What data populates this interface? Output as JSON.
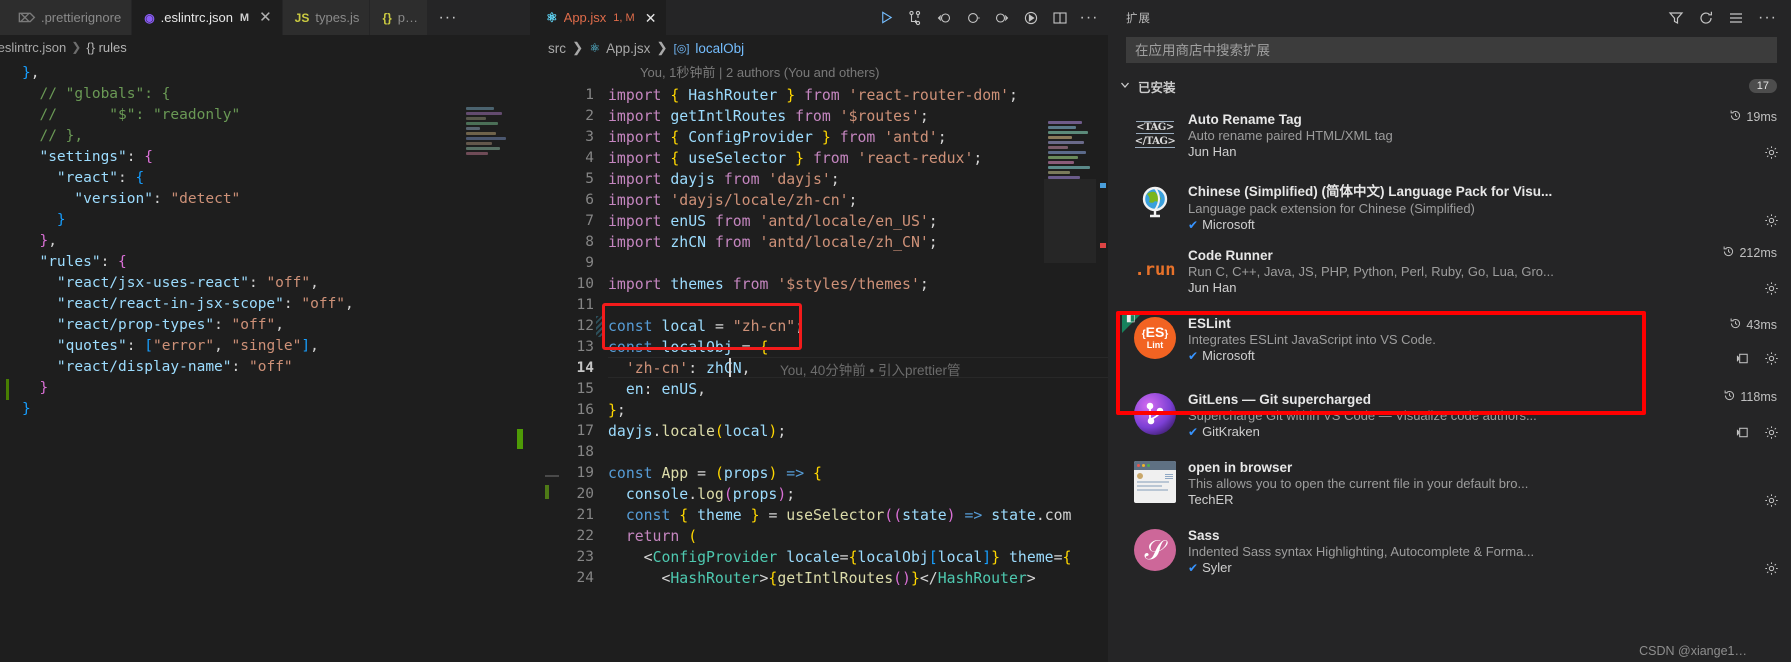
{
  "left_editor": {
    "tabs": [
      {
        "label": ".prettierignore",
        "icon": "file-icon",
        "active": false,
        "dirty": "",
        "closable": false
      },
      {
        "label": ".eslintrc.json",
        "icon": "eslint-icon",
        "active": true,
        "dirty": "M",
        "closable": true
      },
      {
        "label": "types.js",
        "icon": "js-icon",
        "active": false,
        "dirty": "",
        "closable": false
      },
      {
        "label": "package.json",
        "icon": "json-icon",
        "active": false,
        "dirty": "",
        "closable": false
      }
    ],
    "more_label": "···",
    "breadcrumb": [
      ".eslintrc.json",
      "{} rules"
    ],
    "code_lines": [
      "  },",
      "  // \"globals\": {",
      "  //      \"$\": \"readonly\"",
      "  // },",
      "  \"settings\": {",
      "    \"react\": {",
      "      \"version\": \"detect\"",
      "    }",
      "  },",
      "  \"rules\": {",
      "    \"react/jsx-uses-react\": \"off\",",
      "    \"react/react-in-jsx-scope\": \"off\",",
      "    \"react/prop-types\": \"off\",",
      "    \"quotes\": [\"error\", \"single\"],",
      "    \"react/display-name\": \"off\"",
      "  }",
      "}"
    ]
  },
  "main_editor": {
    "tab": {
      "label": "App.jsx",
      "badge": "1, M",
      "close": "✕",
      "icon": "react-icon"
    },
    "actions": [
      {
        "name": "run-button",
        "glyph": "▷"
      },
      {
        "name": "source-control-icon",
        "glyph": "git"
      },
      {
        "name": "debug-step-back-icon",
        "glyph": "back"
      },
      {
        "name": "debug-restart-icon",
        "glyph": "circle"
      },
      {
        "name": "debug-step-over-icon",
        "glyph": "fwd"
      },
      {
        "name": "run-and-debug-icon",
        "glyph": "play-circle"
      },
      {
        "name": "split-editor-icon",
        "glyph": "split"
      },
      {
        "name": "more-actions-icon",
        "glyph": "···"
      }
    ],
    "breadcrumb": [
      "src",
      "App.jsx",
      "localObj"
    ],
    "blame_header": "You, 1秒钟前 | 2 authors (You and others)",
    "inline_blame": "You, 40分钟前 • 引入prettier管",
    "lines": [
      {
        "n": 1,
        "text": "import { HashRouter } from 'react-router-dom';"
      },
      {
        "n": 2,
        "text": "import getIntlRoutes from '$routes';"
      },
      {
        "n": 3,
        "text": "import { ConfigProvider } from 'antd';"
      },
      {
        "n": 4,
        "text": "import { useSelector } from 'react-redux';"
      },
      {
        "n": 5,
        "text": "import dayjs from 'dayjs';"
      },
      {
        "n": 6,
        "text": "import 'dayjs/locale/zh-cn';"
      },
      {
        "n": 7,
        "text": "import enUS from 'antd/locale/en_US';"
      },
      {
        "n": 8,
        "text": "import zhCN from 'antd/locale/zh_CN';"
      },
      {
        "n": 9,
        "text": ""
      },
      {
        "n": 10,
        "text": "import themes from '$styles/themes';"
      },
      {
        "n": 11,
        "text": ""
      },
      {
        "n": 12,
        "text": "const local = \"zh-cn\";"
      },
      {
        "n": 13,
        "text": "const localObj = {"
      },
      {
        "n": 14,
        "text": "  'zh-cn': zhCN,"
      },
      {
        "n": 15,
        "text": "  en: enUS,"
      },
      {
        "n": 16,
        "text": "};"
      },
      {
        "n": 17,
        "text": "dayjs.locale(local);"
      },
      {
        "n": 18,
        "text": ""
      },
      {
        "n": 19,
        "text": "const App = (props) => {"
      },
      {
        "n": 20,
        "text": "  console.log(props);"
      },
      {
        "n": 21,
        "text": "  const { theme } = useSelector((state) => state.com"
      },
      {
        "n": 22,
        "text": "  return ("
      },
      {
        "n": 23,
        "text": "    <ConfigProvider locale={localObj[local]} theme={"
      },
      {
        "n": 24,
        "text": "      <HashRouter>{getIntlRoutes()}</HashRouter>"
      }
    ],
    "current_line": 14,
    "highlight_line": 12
  },
  "sidebar": {
    "title": "扩展",
    "header_actions": [
      {
        "name": "filter-icon",
        "glyph": "filter"
      },
      {
        "name": "refresh-icon",
        "glyph": "refresh"
      },
      {
        "name": "list-view-icon",
        "glyph": "list"
      },
      {
        "name": "more-actions-icon",
        "glyph": "···"
      }
    ],
    "search": {
      "placeholder": "在应用商店中搜索扩展",
      "value": ""
    },
    "section": {
      "label": "已安装",
      "count": "17",
      "chevron": "⌄"
    },
    "extensions": [
      {
        "name": "Auto Rename Tag",
        "description": "Auto rename paired HTML/XML tag",
        "publisher": "Jun Han",
        "verified": false,
        "timing": "19ms",
        "icon": "auto-rename-tag-icon",
        "has_gear": true,
        "has_window_icon": false,
        "highlighted": false
      },
      {
        "name": "Chinese (Simplified) (简体中文) Language Pack for Visu...",
        "description": "Language pack extension for Chinese (Simplified)",
        "publisher": "Microsoft",
        "verified": true,
        "timing": "",
        "icon": "globe-icon",
        "has_gear": true,
        "has_window_icon": false,
        "highlighted": false
      },
      {
        "name": "Code Runner",
        "description": "Run C, C++, Java, JS, PHP, Python, Perl, Ruby, Go, Lua, Gro...",
        "publisher": "Jun Han",
        "verified": false,
        "timing": "212ms",
        "icon": "code-runner-icon",
        "has_gear": true,
        "has_window_icon": false,
        "highlighted": false
      },
      {
        "name": "ESLint",
        "description": "Integrates ESLint JavaScript into VS Code.",
        "publisher": "Microsoft",
        "verified": true,
        "timing": "43ms",
        "icon": "eslint-icon",
        "has_gear": true,
        "has_window_icon": true,
        "highlighted": true
      },
      {
        "name": "GitLens — Git supercharged",
        "description": "Supercharge Git within VS Code — Visualize code authors...",
        "publisher": "GitKraken",
        "verified": true,
        "timing": "118ms",
        "icon": "gitlens-icon",
        "has_gear": true,
        "has_window_icon": true,
        "highlighted": false
      },
      {
        "name": "open in browser",
        "description": "This allows you to open the current file in your default bro...",
        "publisher": "TechER",
        "verified": false,
        "timing": "",
        "icon": "open-in-browser-icon",
        "has_gear": true,
        "has_window_icon": false,
        "highlighted": false
      },
      {
        "name": "Sass",
        "description": "Indented Sass syntax Highlighting, Autocomplete & Forma...",
        "publisher": "Syler",
        "verified": true,
        "timing": "",
        "icon": "sass-icon",
        "has_gear": true,
        "has_window_icon": false,
        "highlighted": false
      }
    ],
    "watermark": "CSDN @xiange1…"
  },
  "colors": {
    "editor_bg": "#1e1e1e",
    "sidebar_bg": "#252526",
    "tab_inactive_bg": "#2d2d2d",
    "highlight_red": "#ff0000",
    "accent_blue": "#3794ff",
    "eslint_orange": "#f26322",
    "badge_bg": "#4d4d4d"
  }
}
